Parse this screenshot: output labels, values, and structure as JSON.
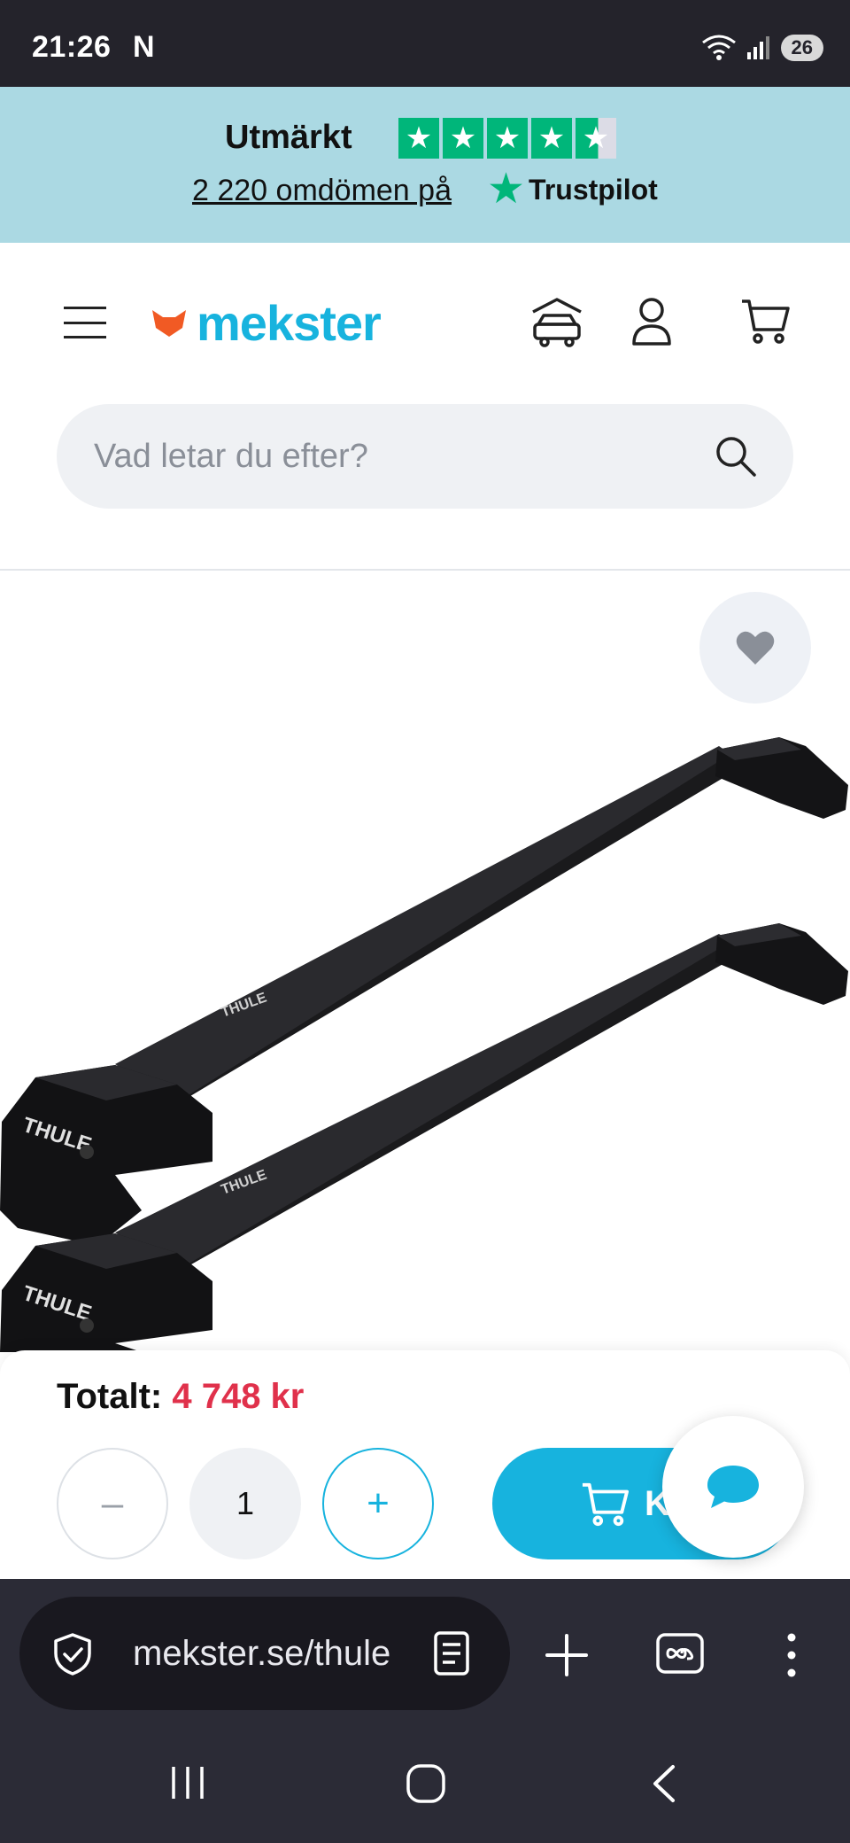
{
  "status_bar": {
    "time": "21:26",
    "app_indicator": "N",
    "battery": "26",
    "icons": [
      "wifi-icon",
      "signal-icon",
      "battery-icon"
    ]
  },
  "trustpilot": {
    "rating_label": "Utmärkt",
    "stars": 4.5,
    "reviews_text": "2 220 omdömen på",
    "brand": "Trustpilot",
    "color": "#00b67a"
  },
  "header": {
    "logo_text": "mekster",
    "brand_color": "#17b3de",
    "accent_color": "#f15a24",
    "icons": [
      "menu-icon",
      "car-garage-icon",
      "user-icon",
      "cart-icon"
    ]
  },
  "search": {
    "placeholder": "Vad letar du efter?"
  },
  "product": {
    "image_alt": "Thule takräcke",
    "brand_mark": "THULE"
  },
  "purchase": {
    "total_label": "Totalt:",
    "total_price": "4 748 kr",
    "quantity": "1",
    "minus_label": "–",
    "plus_label": "+",
    "buy_label": "K",
    "price_color": "#e0314b"
  },
  "browser": {
    "url": "mekster.se/thule",
    "icons": [
      "shield-check-icon",
      "reader-mode-icon",
      "new-tab-icon",
      "tabs-icon",
      "more-icon"
    ]
  },
  "nav": {
    "icons": [
      "recents-icon",
      "home-icon",
      "back-icon"
    ]
  }
}
